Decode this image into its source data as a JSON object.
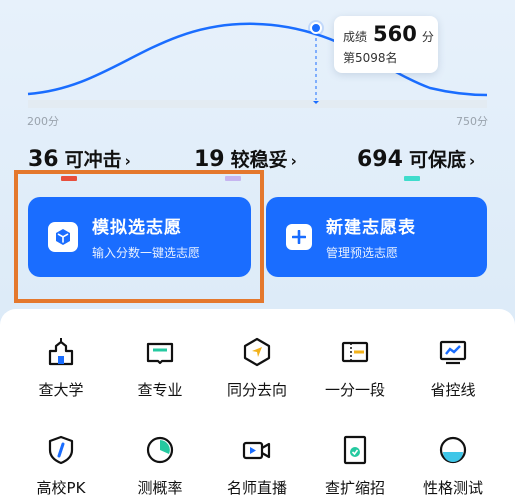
{
  "chart": {
    "axis_min": "200分",
    "axis_max": "750分",
    "tooltip": {
      "label": "成绩",
      "score": "560",
      "unit": "分",
      "rank": "第5098名"
    }
  },
  "stats": [
    {
      "count": "36",
      "label": "可冲击",
      "color": "#e84f3d"
    },
    {
      "count": "19",
      "label": "较稳妥",
      "color": "#c6b5f0"
    },
    {
      "count": "694",
      "label": "可保底",
      "color": "#3fdccc"
    }
  ],
  "chevron": "›",
  "cards": {
    "simulate": {
      "title": "模拟选志愿",
      "subtitle": "输入分数一键选志愿"
    },
    "create": {
      "title": "新建志愿表",
      "subtitle": "管理预选志愿"
    }
  },
  "grid": [
    {
      "label": "查大学",
      "icon": "school-building-icon"
    },
    {
      "label": "查专业",
      "icon": "book-icon"
    },
    {
      "label": "同分去向",
      "icon": "direction-hexagon-icon"
    },
    {
      "label": "一分一段",
      "icon": "ticket-icon"
    },
    {
      "label": "省控线",
      "icon": "trend-monitor-icon"
    },
    {
      "label": "高校PK",
      "icon": "shield-pk-icon"
    },
    {
      "label": "测概率",
      "icon": "pie-chart-icon"
    },
    {
      "label": "名师直播",
      "icon": "video-camera-icon"
    },
    {
      "label": "查扩缩招",
      "icon": "document-check-icon"
    },
    {
      "label": "性格测试",
      "icon": "half-circle-test-icon"
    }
  ],
  "colors": {
    "primary": "#1a6dff",
    "highlight_border": "#e4782d",
    "curve": "#1a6dff"
  }
}
